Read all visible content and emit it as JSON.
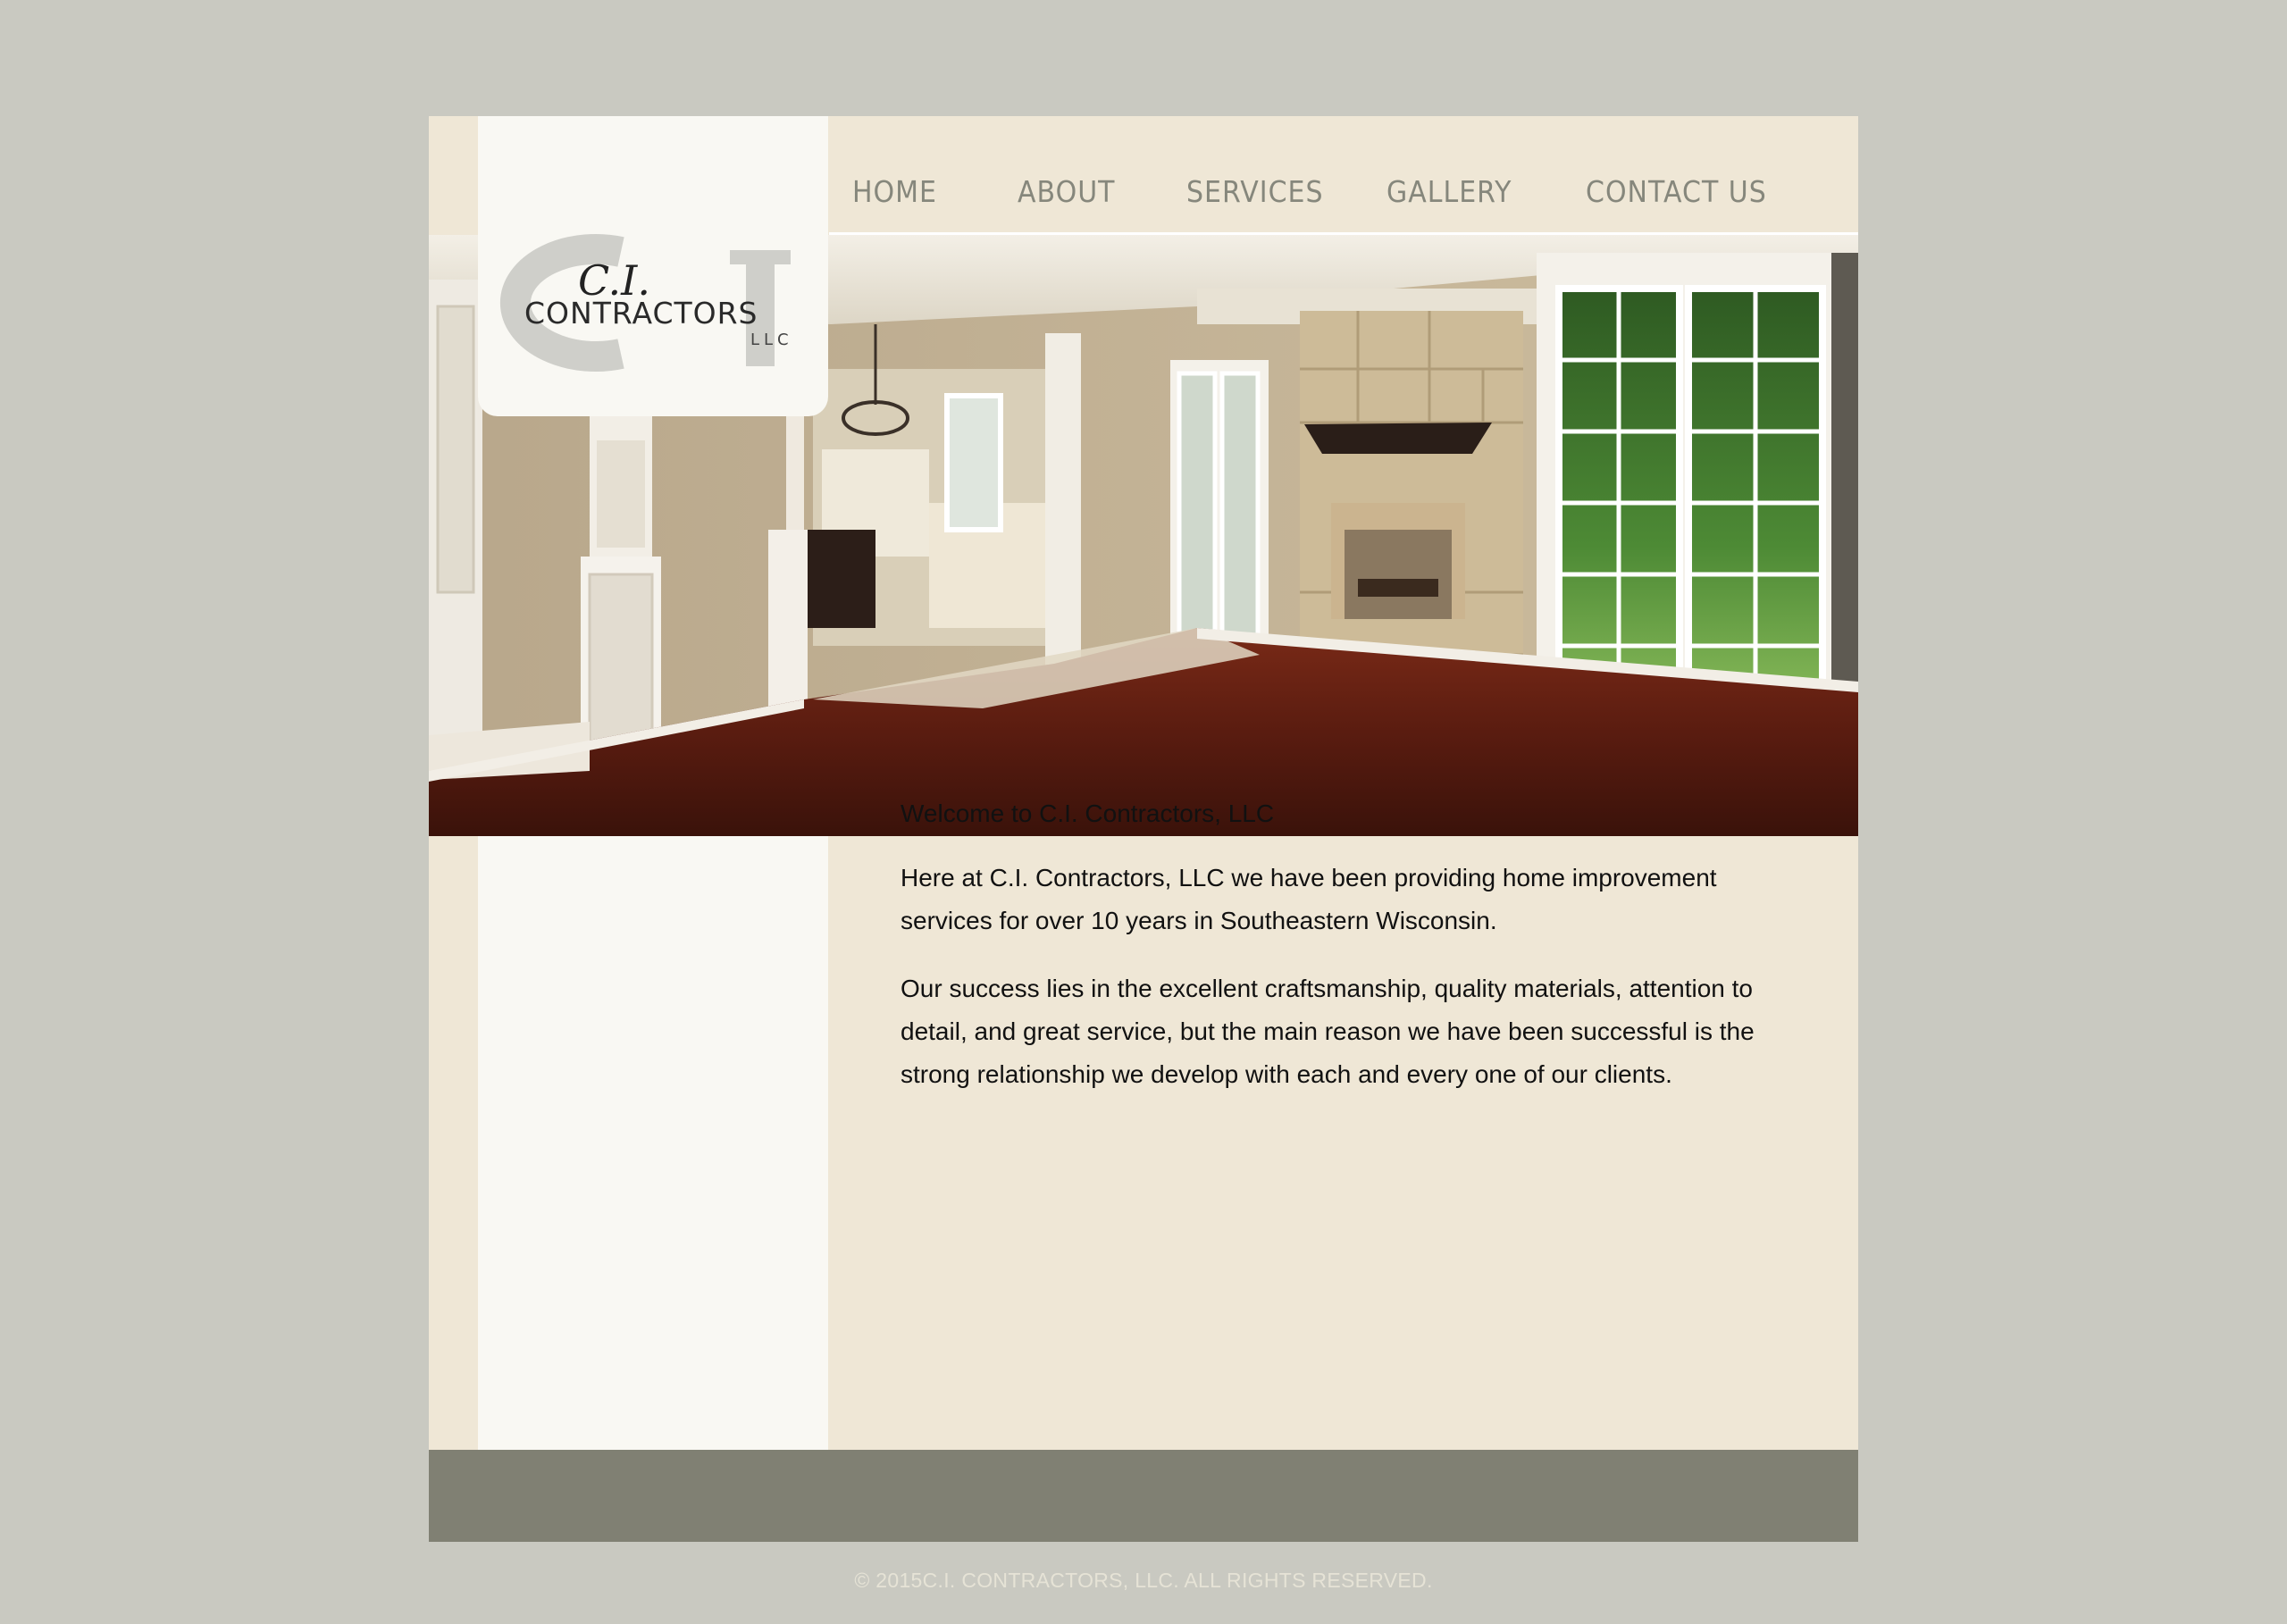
{
  "brand": {
    "logo_line1": "C.I.",
    "logo_line2": "CONTRACTORS",
    "logo_line3": "LLC"
  },
  "nav": [
    {
      "label": "HOME"
    },
    {
      "label": "ABOUT"
    },
    {
      "label": "SERVICES"
    },
    {
      "label": "GALLERY"
    },
    {
      "label": "CONTACT US"
    }
  ],
  "hero": {
    "description": ""
  },
  "main": {
    "heading": "Welcome to C.I. Contractors, LLC",
    "paragraphs": [
      "Here at C.I. Contractors, LLC we have been providing home improvement services for over 10 years in Southeastern Wisconsin.",
      "Our success lies in the excellent craftsmanship, quality materials, attention to detail, and great service, but the main reason we have been successful is the strong relationship we develop with each and every one of our clients."
    ]
  },
  "footer": {
    "copyright": "© 2015C.I. CONTRACTORS, LLC. ALL RIGHTS RESERVED."
  },
  "colors": {
    "page_bg": "#c9c9c1",
    "site_bg": "#efe7d6",
    "left_column": "#f9f8f3",
    "footer_bar": "#808073",
    "nav_text": "#86877c"
  }
}
